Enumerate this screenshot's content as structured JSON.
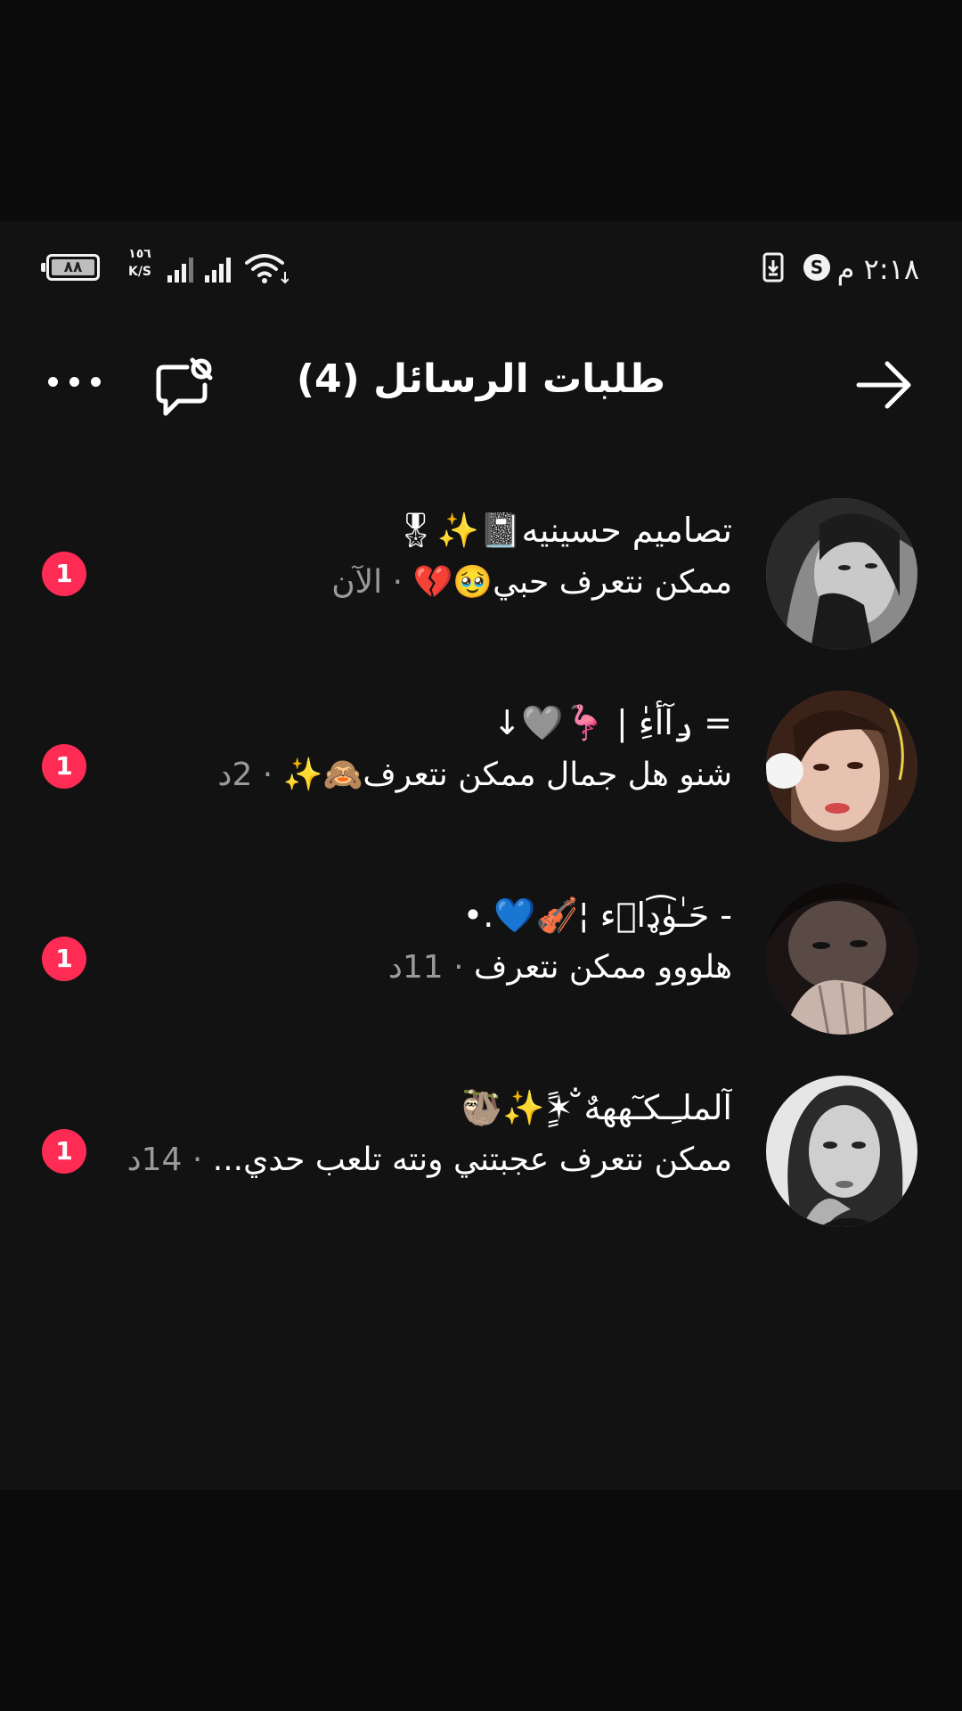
{
  "status_bar": {
    "time": "٢:١٨ م",
    "s_badge": "S",
    "battery": "٨٨",
    "speed_value": "١٥٦",
    "speed_unit": "K/S",
    "icons": [
      "download-icon",
      "s-app-icon",
      "battery-icon",
      "cell-signal-icon",
      "wifi-icon"
    ]
  },
  "header": {
    "title": "طلبات الرسائل (4)",
    "back_icon": "arrow-icon",
    "settings_icon": "message-settings-icon",
    "more_icon": "more-icon"
  },
  "requests": [
    {
      "name": "تصاميم حسينيه📓✨🎖",
      "message": "ممكن نتعرف حبي🥹💔",
      "separator": " · ",
      "time": "الآن",
      "unread": "1"
    },
    {
      "name": "= ݛآأ̍ءِ | 🦩🩶↓",
      "message": "شنو هل جمال ممكن نتعرف🙈✨",
      "separator": " · ",
      "time": "2د",
      "unread": "1"
    },
    {
      "name": "- حَـٰوٰ͡ډاۜء ¦🎻💙.•",
      "message": "هلووو ممكن نتعرف",
      "separator": " · ",
      "time": "11د",
      "unread": "1"
    },
    {
      "name": "آلملـِـكـٓهههٌ̐ ✶ًٍ✨🦥",
      "message": "ممكن نتعرف عجبتني ونته تلعب حدي...",
      "separator": " · ",
      "time": "14د",
      "unread": "1"
    }
  ],
  "colors": {
    "background": "#121212",
    "badge": "#fe2c55",
    "secondary_text": "#9a9a9a",
    "primary_text": "#ffffff"
  }
}
